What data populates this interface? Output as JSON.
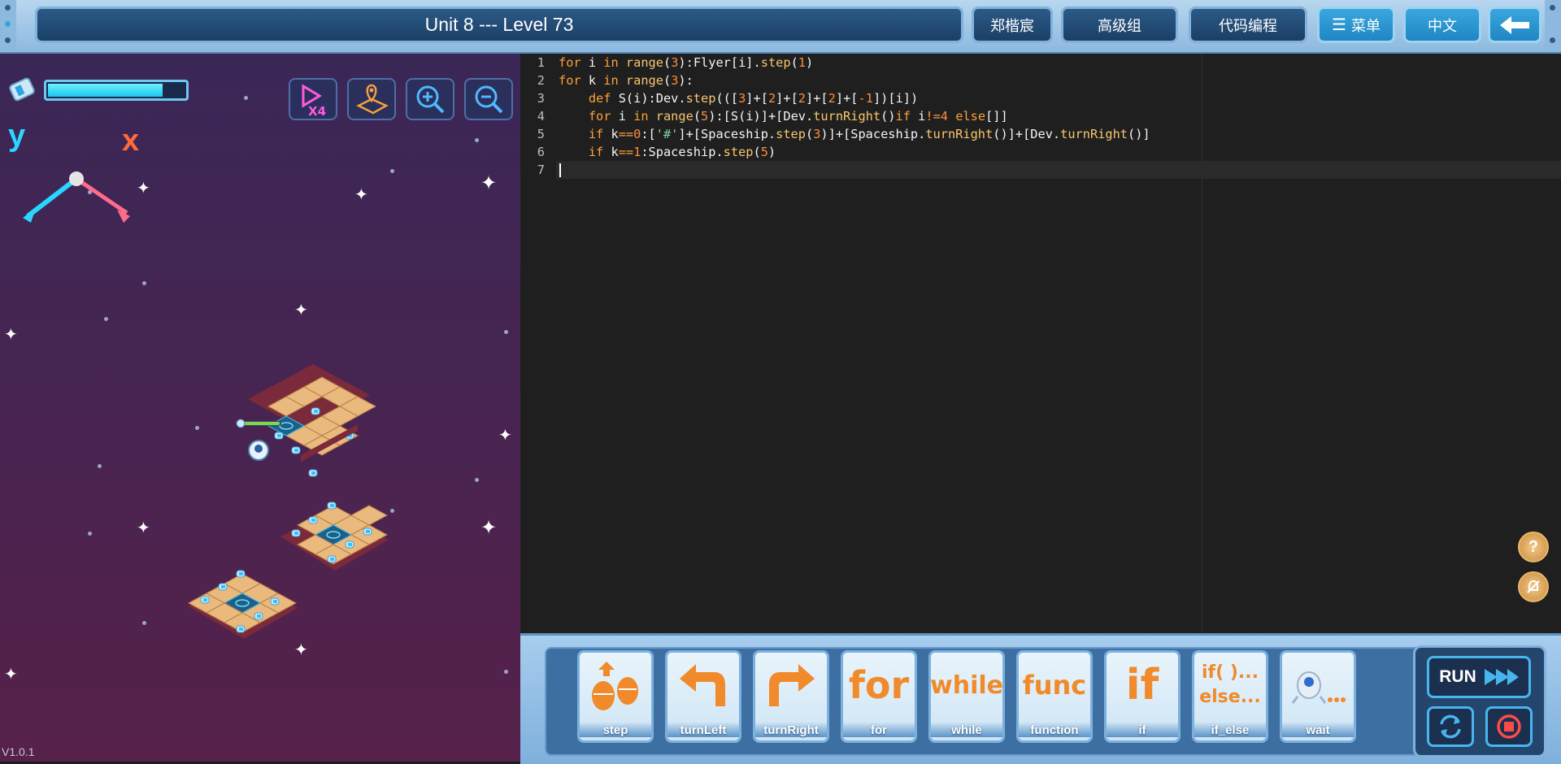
{
  "header": {
    "title": "Unit 8 --- Level 73",
    "user": "郑楷宸",
    "group": "高级组",
    "mode": "代码编程",
    "menu": "菜单",
    "language": "中文",
    "back_icon": "back-arrow-icon"
  },
  "game": {
    "energy_level": 0.82,
    "axis_y": "y",
    "axis_x": "x",
    "speed_label": "X4",
    "version": "V1.0.1",
    "buttons": [
      "speed-x4-icon",
      "map-locate-icon",
      "zoom-in-icon",
      "zoom-out-icon"
    ]
  },
  "editor": {
    "lines": [
      {
        "n": "1",
        "html": "<span class='kw'>for</span> i <span class='kw'>in</span> <span class='fn'>range</span>(<span class='num'>3</span>):Flyer[i].<span class='fn'>step</span>(<span class='num'>1</span>)"
      },
      {
        "n": "2",
        "html": "<span class='kw'>for</span> k <span class='kw'>in</span> <span class='fn'>range</span>(<span class='num'>3</span>):"
      },
      {
        "n": "3",
        "html": "    <span class='kw'>def</span> S(i):Dev.<span class='fn'>step</span>(([<span class='num'>3</span>]+[<span class='num'>2</span>]+[<span class='num'>2</span>]+[<span class='num'>2</span>]+[<span class='num'>-1</span>])[i])"
      },
      {
        "n": "4",
        "html": "    <span class='kw'>for</span> i <span class='kw'>in</span> <span class='fn'>range</span>(<span class='num'>5</span>):[S(i)]+[Dev.<span class='fn'>turnRight</span>()<span class='kw'>if</span> i<span class='kw'>!=</span><span class='num'>4</span> <span class='kw'>else</span>[]]"
      },
      {
        "n": "5",
        "html": "    <span class='kw'>if</span> k<span class='kw'>==</span><span class='num'>0</span>:[<span class='str'>'#'</span>]+[Spaceship.<span class='fn'>step</span>(<span class='num'>3</span>)]+[Spaceship.<span class='fn'>turnRight</span>()]+[Dev.<span class='fn'>turnRight</span>()]"
      },
      {
        "n": "6",
        "html": "    <span class='kw'>if</span> k<span class='kw'>==</span><span class='num'>1</span>:Spaceship.<span class='fn'>step</span>(<span class='num'>5</span>)"
      },
      {
        "n": "7",
        "html": ""
      }
    ],
    "help_icon": "help-icon",
    "mute_icon": "mute-bell-icon"
  },
  "blocks": [
    {
      "label": "step",
      "glyph": "step-icon"
    },
    {
      "label": "turnLeft",
      "glyph": "turn-left-icon"
    },
    {
      "label": "turnRight",
      "glyph": "turn-right-icon"
    },
    {
      "label": "for",
      "glyph": "for"
    },
    {
      "label": "while",
      "glyph": "while"
    },
    {
      "label": "function",
      "glyph": "func"
    },
    {
      "label": "if",
      "glyph": "if"
    },
    {
      "label": "if_else",
      "glyph": "if( )...\nelse..."
    },
    {
      "label": "wait",
      "glyph": "wait-icon"
    }
  ],
  "controls": {
    "run": "RUN",
    "reset_icon": "reset-icon",
    "stop_icon": "stop-icon"
  }
}
